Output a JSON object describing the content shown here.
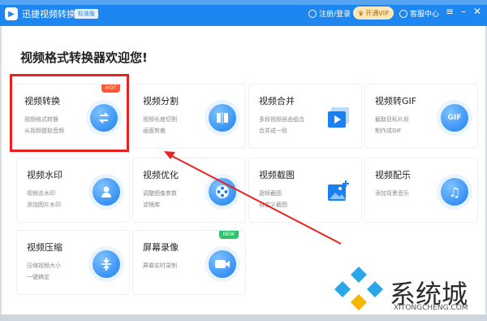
{
  "titlebar": {
    "app_name": "迅捷视频转换器",
    "edition": "标准版",
    "login": "注册/登录",
    "vip": "开通VIP",
    "help": "客服中心"
  },
  "welcome": "视频格式转换器欢迎您!",
  "cards": [
    {
      "title": "视频转换",
      "desc1": "视频格式转换",
      "desc2": "从视频提取音频",
      "icon": "convert-arrows-icon",
      "tag": "HOT"
    },
    {
      "title": "视频分割",
      "desc1": "视频长度切割",
      "desc2": "画面剪裁",
      "icon": "split-icon"
    },
    {
      "title": "视频合并",
      "desc1": "多段视频自由组合",
      "desc2": "合并成一段",
      "icon": "play-merge-icon"
    },
    {
      "title": "视频转GIF",
      "desc1": "截取目标片段",
      "desc2": "制作成GIF",
      "icon": "gif-icon",
      "icon_text": "GIF"
    },
    {
      "title": "视频水印",
      "desc1": "视频去水印",
      "desc2": "添加图片水印",
      "icon": "person-watermark-icon"
    },
    {
      "title": "视频优化",
      "desc1": "调整图像参数",
      "desc2": "滤镜库",
      "icon": "film-reel-icon"
    },
    {
      "title": "视频截图",
      "desc1": "逐帧截图",
      "desc2": "自定义截图",
      "icon": "image-add-icon"
    },
    {
      "title": "视频配乐",
      "desc1": "添加背景音乐",
      "desc2": "",
      "icon": "music-note-icon"
    },
    {
      "title": "视频压缩",
      "desc1": "压缩视频大小",
      "desc2": "一键搞定",
      "icon": "compress-icon"
    },
    {
      "title": "屏幕录像",
      "desc1": "屏幕实时录制",
      "desc2": "",
      "icon": "camera-record-icon",
      "tag": "NEW"
    }
  ],
  "watermark": {
    "text": "系统城",
    "sub": "XITONGCHENG.COM"
  },
  "colors": {
    "primary": "#1e86f0",
    "highlight": "#e8231f",
    "hot": "#ff5a34",
    "new": "#2dc36b"
  }
}
